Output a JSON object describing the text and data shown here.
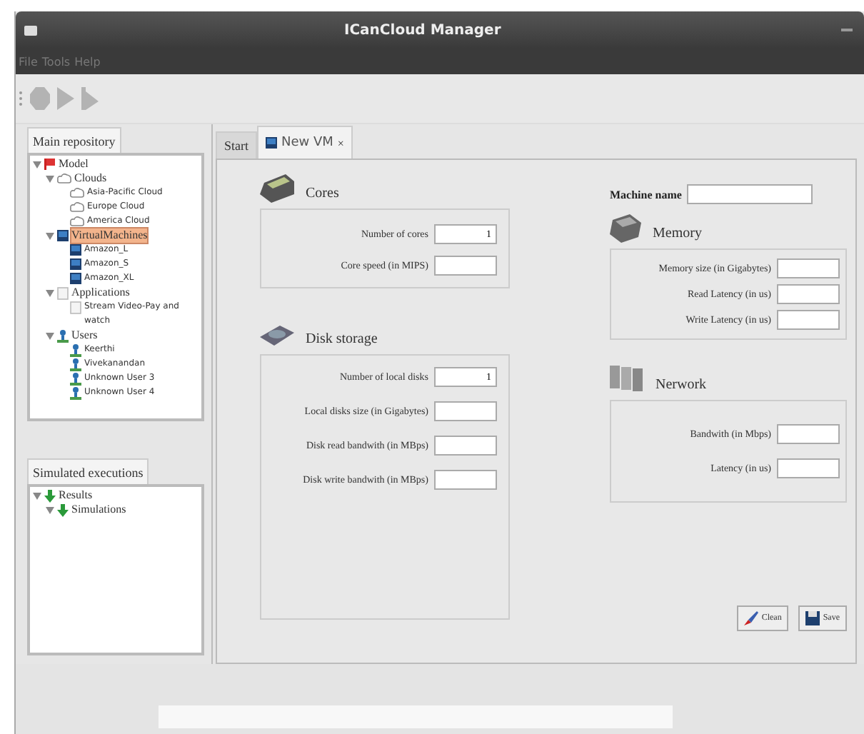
{
  "window": {
    "title": "ICanCloud Manager"
  },
  "menu": [
    "File",
    "Tools",
    "Help"
  ],
  "toolbar": [
    {
      "kind": "stop",
      "disabled": true
    },
    {
      "kind": "play",
      "disabled": true
    },
    {
      "kind": "step",
      "disabled": true
    }
  ],
  "repository": {
    "tab": "Main repository",
    "tree": [
      {
        "label": "Model",
        "kind": "model",
        "expanded": true,
        "selected": false,
        "children": [
          {
            "label": "Clouds",
            "kind": "clouds",
            "expanded": true,
            "selected": false,
            "children": [
              {
                "label": "Asia-Pacific Cloud",
                "kind": "cloud",
                "selected": false
              },
              {
                "label": "Europe Cloud",
                "kind": "cloud",
                "selected": false
              },
              {
                "label": "America Cloud",
                "kind": "cloud",
                "selected": false
              }
            ]
          },
          {
            "label": "VirtualMachines",
            "kind": "vm",
            "expanded": true,
            "selected": true,
            "children": [
              {
                "label": "Amazon_L",
                "kind": "vm",
                "selected": false
              },
              {
                "label": "Amazon_S",
                "kind": "vm",
                "selected": false
              },
              {
                "label": "Amazon_XL",
                "kind": "vm",
                "selected": false
              }
            ]
          },
          {
            "label": "Applications",
            "kind": "apps",
            "expanded": true,
            "selected": false,
            "children": [
              {
                "label": "Stream Video-Pay and watch",
                "kind": "app",
                "selected": false
              }
            ]
          },
          {
            "label": "Users",
            "kind": "user",
            "expanded": true,
            "selected": false,
            "children": [
              {
                "label": "Keerthi",
                "kind": "user",
                "selected": false
              },
              {
                "label": "Vivekanandan",
                "kind": "user",
                "selected": false
              },
              {
                "label": "Unknown User 3",
                "kind": "user",
                "selected": false
              },
              {
                "label": "Unknown User 4",
                "kind": "user",
                "selected": false
              }
            ]
          }
        ]
      }
    ]
  },
  "executions": {
    "tab": "Simulated executions",
    "tree": [
      {
        "label": "Results",
        "kind": "result",
        "expanded": true,
        "selected": false,
        "children": [
          {
            "label": "Simulations",
            "kind": "result",
            "expanded": true,
            "selected": false
          }
        ]
      }
    ]
  },
  "tabs": [
    {
      "label": "Start",
      "selected": false
    },
    {
      "label": "New VM",
      "selected": true,
      "close": "×"
    }
  ],
  "left_column": [
    {
      "title": "Cores",
      "kind": "cpu",
      "fields": [
        {
          "label": "Number of cores",
          "value": "1"
        },
        {
          "label": "Core speed (in MIPS)"
        }
      ]
    },
    {
      "title": "Disk storage",
      "kind": "disk",
      "fields": [
        {
          "label": "Number of local disks",
          "value": "1"
        },
        {
          "label": "Local disks size (in Gigabytes)"
        },
        {
          "label": "Disk read bandwith (in MBps)"
        },
        {
          "label": "Disk write bandwith (in MBps)"
        }
      ]
    }
  ],
  "machine_name": {
    "label": "Machine name"
  },
  "right_column": [
    {
      "title": "Memory",
      "kind": "memory",
      "fields": [
        {
          "label": "Memory size (in Gigabytes)"
        },
        {
          "label": "Read Latency (in us)"
        },
        {
          "label": "Write Latency (in us)"
        }
      ]
    },
    {
      "title": "Nerwork",
      "kind": "network",
      "fields": [
        {
          "label": "Bandwith (in Mbps)"
        },
        {
          "label": "Latency (in us)"
        }
      ]
    }
  ],
  "buttons": [
    {
      "label": "Clean",
      "kind": "clean"
    },
    {
      "label": "Save",
      "kind": "save"
    }
  ]
}
